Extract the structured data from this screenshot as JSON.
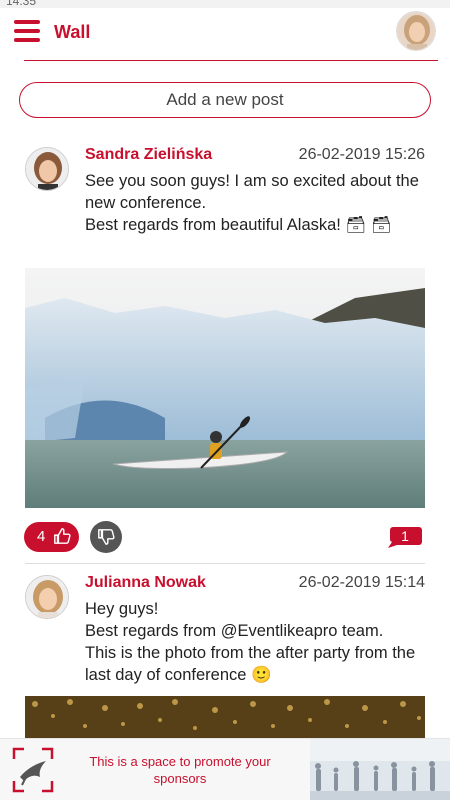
{
  "status": {
    "time": "14:35"
  },
  "header": {
    "title": "Wall",
    "menu_icon": "hamburger-menu-icon",
    "avatar_icon": "user-avatar"
  },
  "add_post": {
    "label": "Add a new post"
  },
  "posts": [
    {
      "author": "Sandra Zielińska",
      "date": "26-02-2019 15:26",
      "text": "See you soon guys! I am so excited about the new conference.\nBest regards from beautiful Alaska! 🗃 🗃",
      "image": "kayak-glacier-photo",
      "likes": "4",
      "comments": "1"
    },
    {
      "author": "Julianna Nowak",
      "date": "26-02-2019 15:14",
      "text": "Hey guys!\nBest regards from @Eventlikeapro team.\nThis is the photo from the after party from the last day of conference 🙂",
      "image": "party-lights-photo"
    }
  ],
  "sponsor": {
    "text": "This is a space to promote your sponsors"
  },
  "colors": {
    "accent": "#c8102e",
    "dislike_bg": "#555555"
  }
}
